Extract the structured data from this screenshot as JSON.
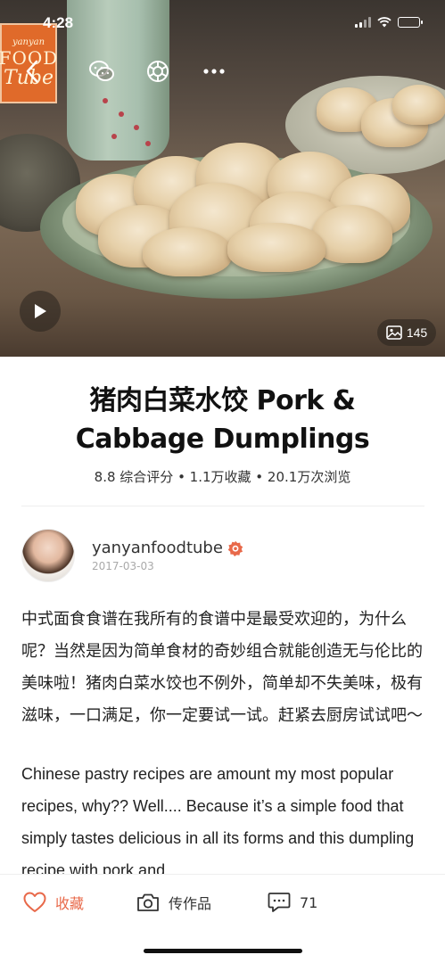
{
  "status_bar": {
    "time": "4:28"
  },
  "hero": {
    "logo_lines": [
      "yanyan",
      "FOOD",
      "Tube"
    ],
    "photo_count": "145",
    "icons": {
      "back": "chevron-left-icon",
      "wechat": "wechat-icon",
      "moments": "moments-icon",
      "more": "more-icon",
      "play": "play-icon",
      "photo": "photo-icon"
    }
  },
  "recipe": {
    "title": "猪肉白菜水饺 Pork & Cabbage Dumplings",
    "stats": "8.8 综合评分 • 1.1万收藏 • 20.1万次浏览"
  },
  "author": {
    "name": "yanyanfoodtube",
    "date": "2017-03-03",
    "badge_color": "#e8694a"
  },
  "description": {
    "chinese": "中式面食食谱在我所有的食谱中是最受欢迎的，为什么呢？当然是因为简单食材的奇妙组合就能创造无与伦比的美味啦！猪肉白菜水饺也不例外，简单却不失美味，极有滋味，一口满足，你一定要试一试。赶紧去厨房试试吧～",
    "english": "Chinese pastry recipes are amount my most popular recipes, why?? Well.... Because it’s a simple food that simply tastes delicious in all its forms and this dumpling recipe with pork and"
  },
  "bottom_bar": {
    "favorite_label": "收藏",
    "post_work_label": "传作品",
    "comment_count": "71",
    "accent_color": "#e8694a"
  }
}
